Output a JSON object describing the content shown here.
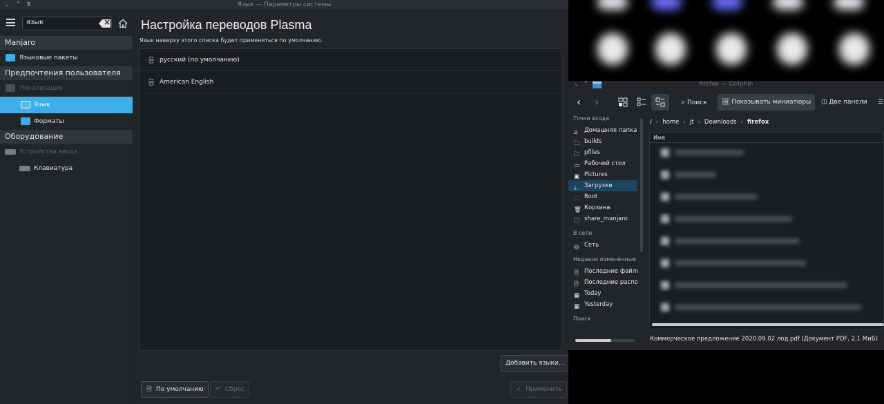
{
  "settings": {
    "window_title": "Язык — Параметры системы",
    "search_value": "язык",
    "sidebar": {
      "group_manjaro": "Manjaro",
      "item_language_packages": "Языковые пакеты",
      "group_user_prefs": "Предпочтения пользователя",
      "item_localization": "Локализация",
      "item_language": "Язык",
      "item_formats": "Форматы",
      "group_hardware": "Оборудование",
      "item_input_devices": "Устройства ввода",
      "item_keyboard": "Клавиатура"
    },
    "page_title": "Настройка переводов Plasma",
    "page_description": "Язык наверху этого списка будет применяться по умолчанию.",
    "languages": [
      "русский (по умолчанию)",
      "American English"
    ],
    "add_languages_label": "Добавить языки...",
    "defaults_label": "По умолчанию",
    "reset_label": "Сброс",
    "apply_label": "Применить",
    "accent_color": "#3daee9"
  },
  "dolphin": {
    "window_title": "firefox — Dolphin",
    "toolbar": {
      "search_label": "Поиск",
      "preview_label": "Показывать миниатюры",
      "split_label": "Две панели"
    },
    "places_header": "Точки входа",
    "places": [
      "Домашняя папка",
      "builds",
      "pfiles",
      "Рабочий стол",
      "Pictures",
      "Загрузки",
      "Root",
      "Корзина",
      "share_manjaro"
    ],
    "network_header": "В сети",
    "network": [
      "Сеть"
    ],
    "recent_header": "Недавно изменённые",
    "recent": [
      "Последние файлы",
      "Последние расположения",
      "Today",
      "Yesterday"
    ],
    "search_header": "Поиск",
    "breadcrumb": [
      "/",
      "home",
      "jt",
      "Downloads",
      "firefox"
    ],
    "column_name": "Имя",
    "status_text": "Коммерческое предложение 2020.09.02 лод.pdf (Документ PDF, 2,1 МиБ)"
  }
}
